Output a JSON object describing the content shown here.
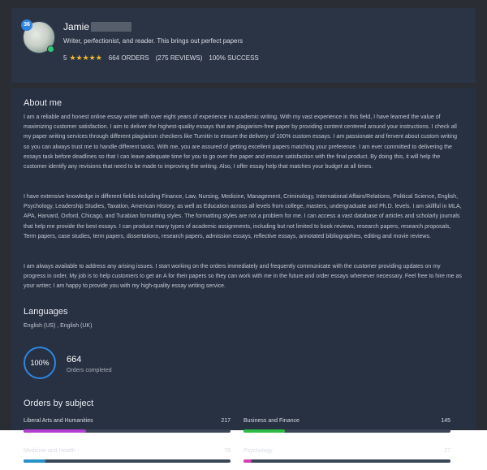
{
  "profile": {
    "level": "36",
    "name": "Jamie",
    "tagline": "Writer, perfectionist, and reader. This brings out perfect papers",
    "rating": "5",
    "stars": "★★★★★",
    "orders": "664 ORDERS",
    "reviews": "(275 REVIEWS)",
    "success": "100% SUCCESS"
  },
  "about": {
    "title": "About me",
    "paragraphs": [
      "I am a reliable and honest online essay writer with over eight years of experience in academic writing. With my vast experience in this field, I have learned the value of maximizing customer satisfaction. I aim to deliver the highest-quality essays that are plagiarism-free paper by providing content centered around your instructions. I check all my paper writing services through different plagiarism checkers like Turnitin to ensure the delivery of 100% custom essays. I am passionate and fervent about custom writing so you can always trust me to handle different tasks. With me, you are assured of getting excellent papers matching your preference. I am ever committed to delivering the essays task before deadlines so that I can leave adequate time for you to go over the paper and ensure satisfaction with the final product. By doing this, it will help the customer identify any revisions that need to be made to improving the writing. Also, I offer essay help that matches your budget at all times.",
      "I have extensive knowledge in different fields including Finance, Law, Nursing, Medicine, Management, Criminology, International Affairs/Relations, Political Science, English, Psychology, Leadership Studies, Taxation, American History, as well as Education across all levels from college, masters, undergraduate and Ph.D. levels. I am skillful in MLA, APA, Harvard, Oxford, Chicago, and Turabian formatting styles. The formatting styles are not a problem for me. I can access a vast database of articles and scholarly journals that help me provide the best essays. I can produce many types of academic assignments, including but not limited to book reviews, research papers, research proposals, Term papers, case studies, term papers, dissertations, research papers, admission essays, reflective essays, annotated bibliographies, editing and movie reviews.",
      "I am always available to address any arising issues. I start working on the orders immediately and frequently communicate with the customer providing updates on my progress in order. My job is to help customers to get an A for their papers so they can work with me in the future and order essays whenever necessary. Feel free to hire me as your writer; I am happy to provide you with my high-quality essay writing service."
    ]
  },
  "languages": {
    "title": "Languages",
    "list": "English (US) ,  English (UK)"
  },
  "completion": {
    "percent_label": "100%",
    "percent": 100,
    "count": "664",
    "label": "Orders completed"
  },
  "subjects": {
    "title": "Orders by subject",
    "max": 217,
    "items": [
      {
        "name": "Liberal Arts and Humanities",
        "count": "217",
        "value": 217,
        "color": "#b23fd1"
      },
      {
        "name": "Business and Finance",
        "count": "145",
        "value": 145,
        "color": "#2dbb45"
      },
      {
        "name": "Medicine and Health",
        "count": "78",
        "value": 78,
        "color": "#2592c9"
      },
      {
        "name": "Psychology",
        "count": "27",
        "value": 27,
        "color": "#d63fb0"
      }
    ]
  }
}
